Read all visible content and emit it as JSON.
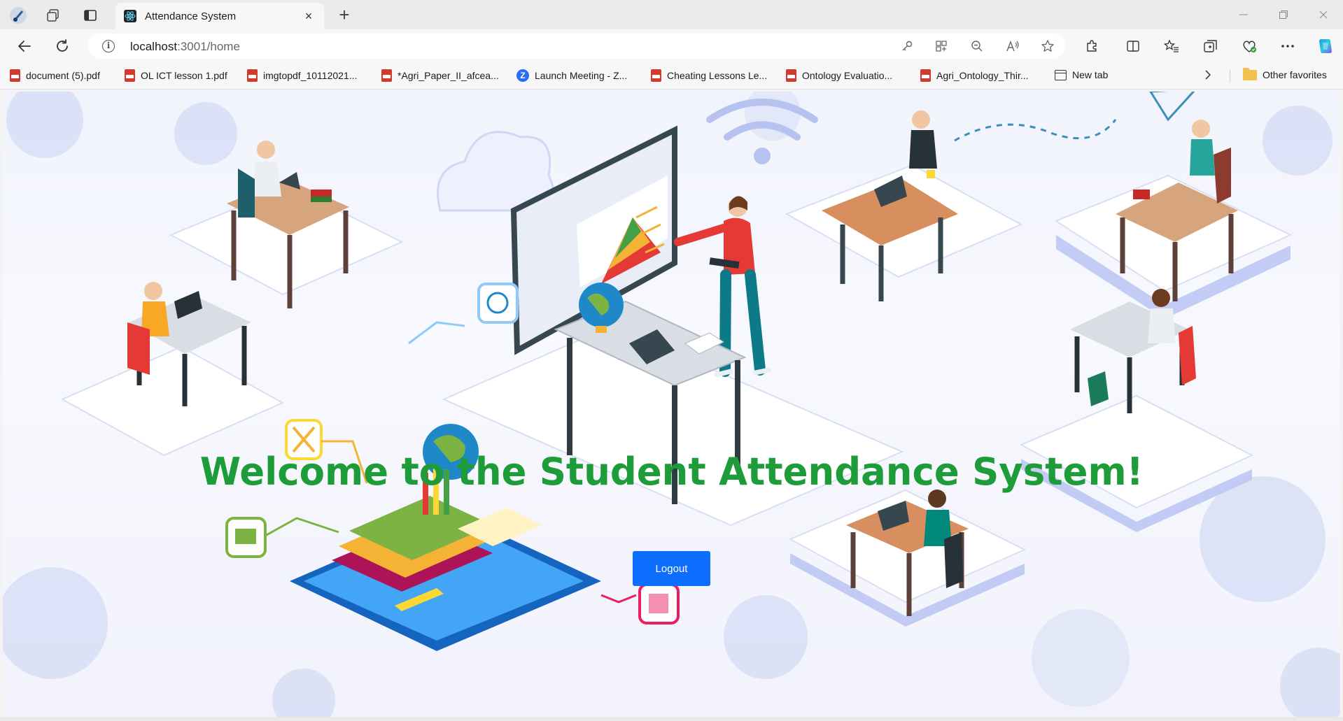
{
  "browser": {
    "tab": {
      "title": "Attendance System",
      "close_glyph": "×"
    },
    "new_tab_glyph": "+",
    "address": {
      "host": "localhost",
      "rest": ":3001/home"
    },
    "favorites": [
      {
        "label": "document (5).pdf",
        "icon": "pdf-icon"
      },
      {
        "label": "OL ICT lesson 1.pdf",
        "icon": "pdf-icon"
      },
      {
        "label": "imgtopdf_10112021...",
        "icon": "pdf-icon"
      },
      {
        "label": "*Agri_Paper_II_afcea...",
        "icon": "pdf-icon"
      },
      {
        "label": "Launch Meeting - Z...",
        "icon": "zoom-icon"
      },
      {
        "label": "Cheating Lessons Le...",
        "icon": "pdf-icon"
      },
      {
        "label": "Ontology Evaluatio...",
        "icon": "pdf-icon"
      },
      {
        "label": "Agri_Ontology_Thir...",
        "icon": "pdf-icon"
      },
      {
        "label": "New tab",
        "icon": "new-tab-icon"
      }
    ],
    "other_favorites": "Other favorites"
  },
  "page": {
    "heading": "Welcome to the Student Attendance System!",
    "logout_label": "Logout"
  },
  "colors": {
    "heading": "#1f9c3a",
    "button": "#0d6efd",
    "accent_illustration": "#b9c4f2"
  }
}
